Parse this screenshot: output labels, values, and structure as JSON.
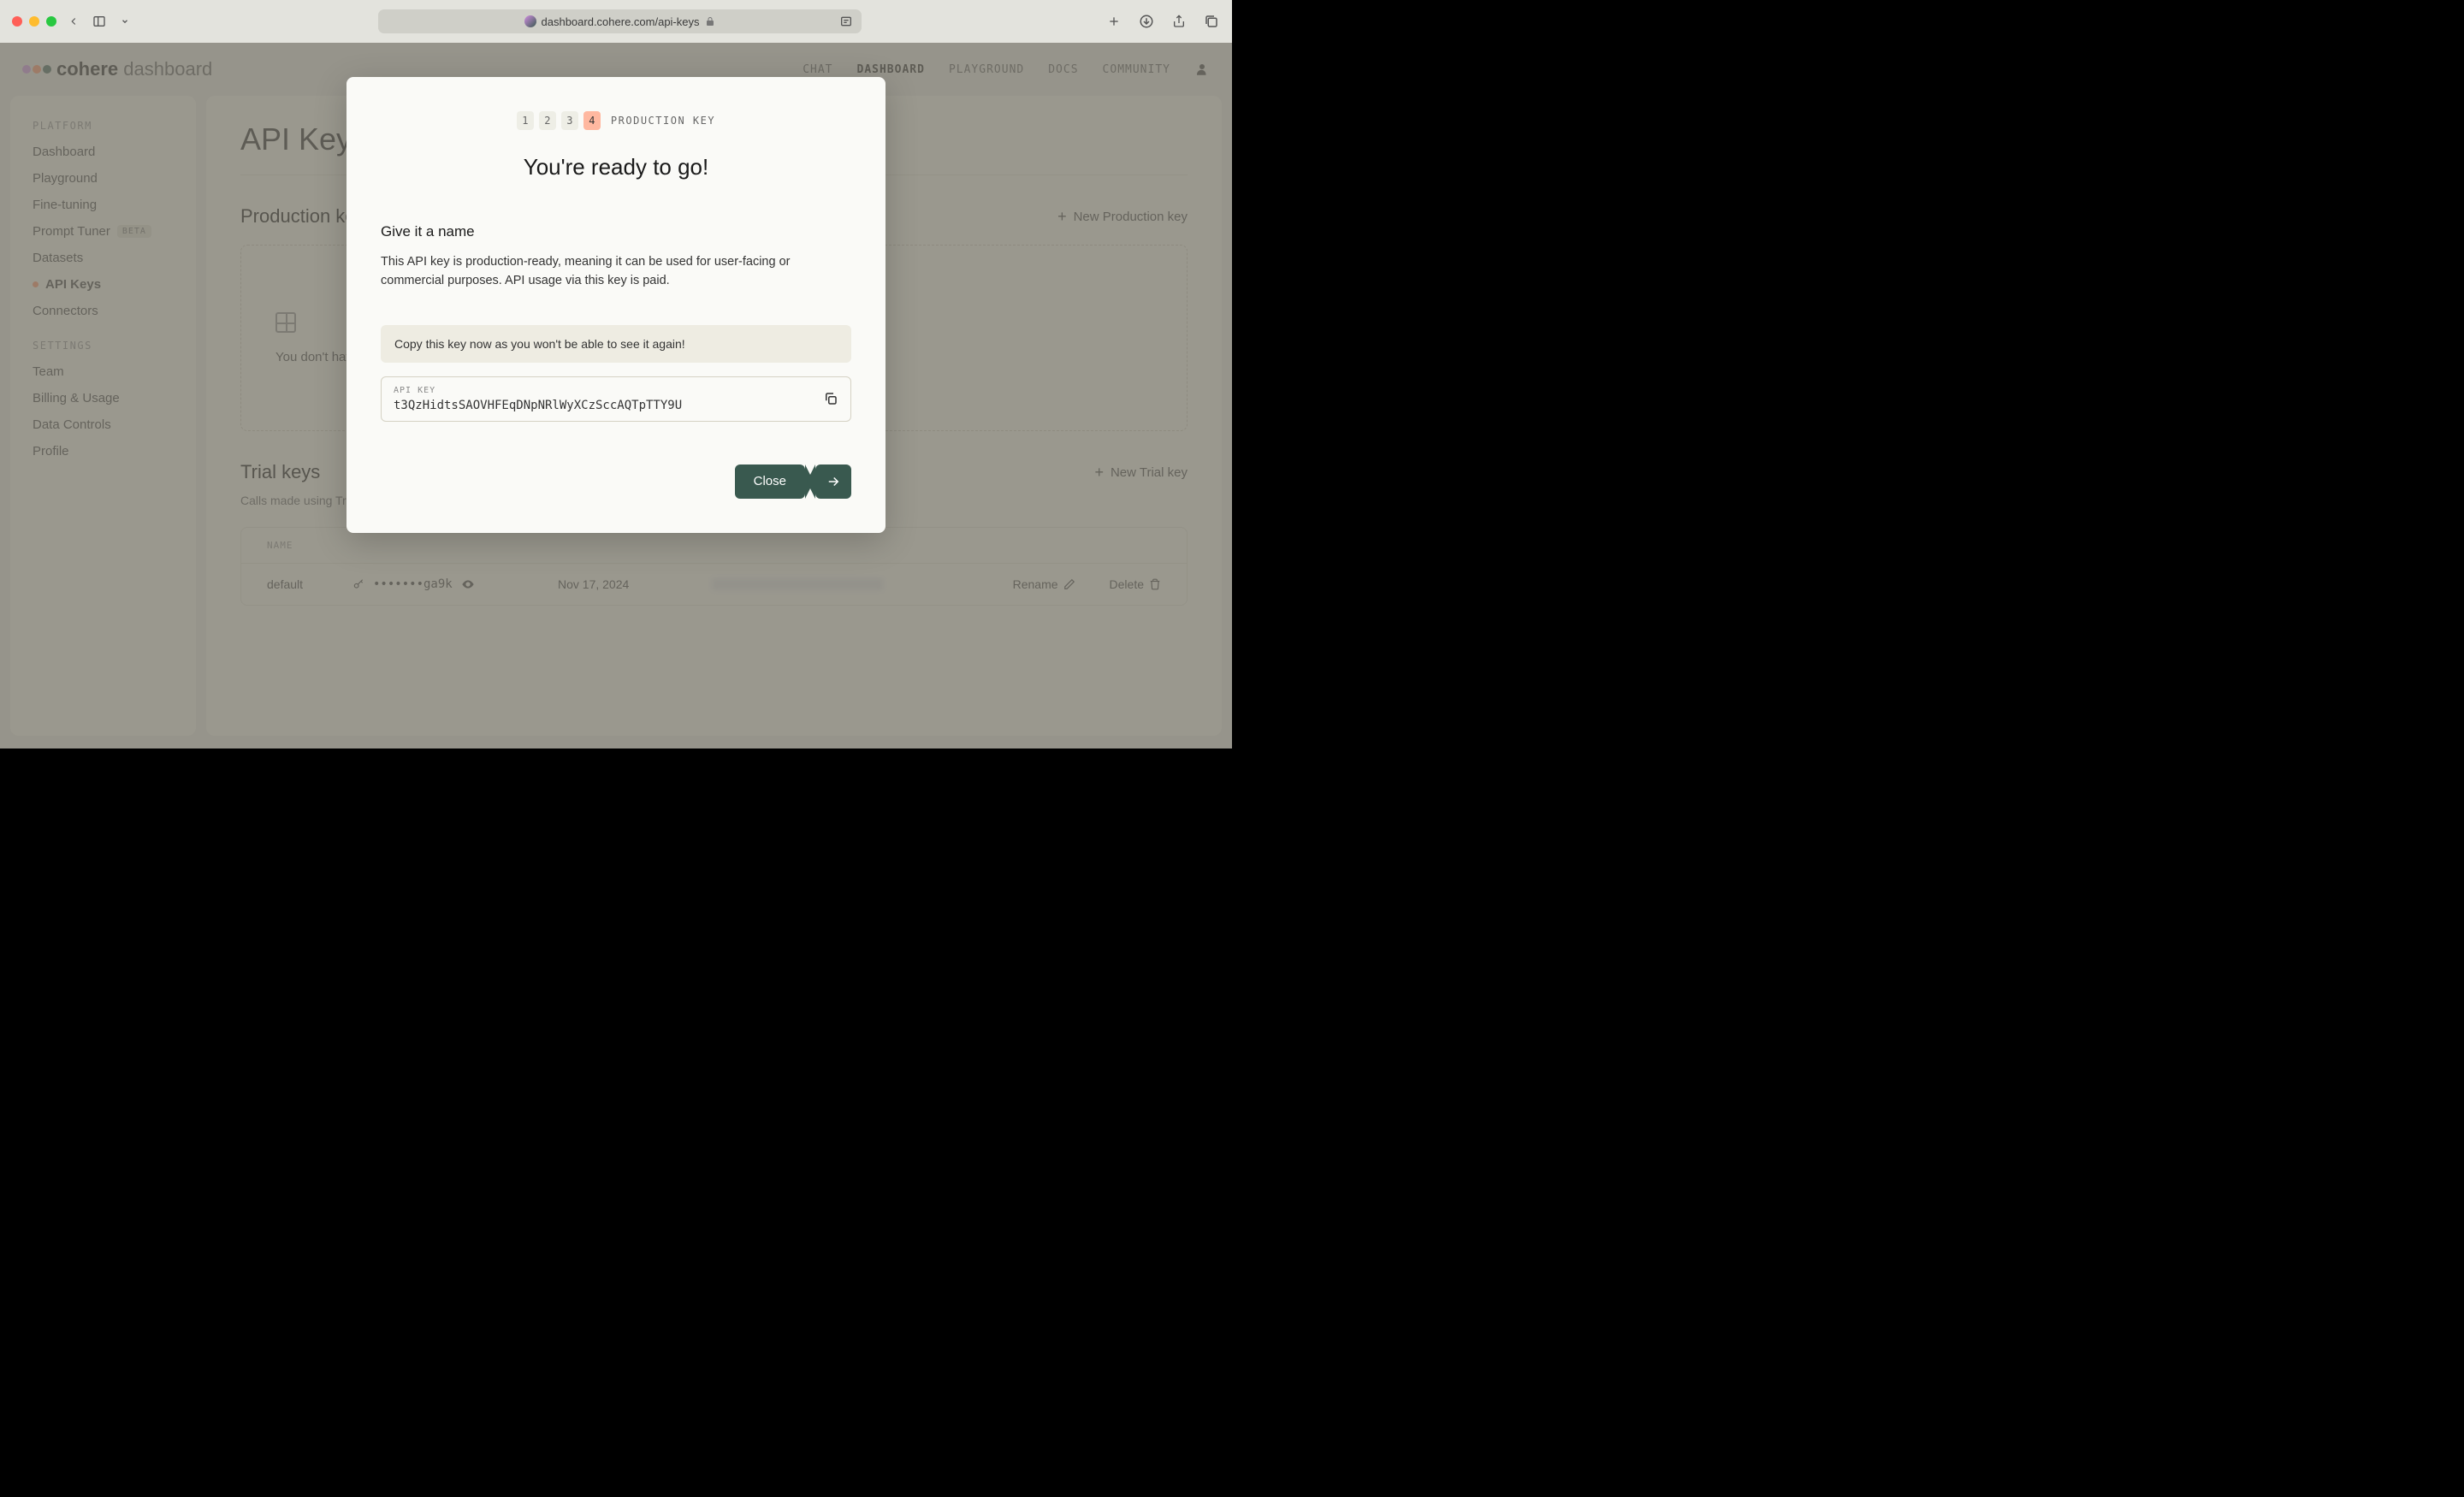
{
  "browser": {
    "url": "dashboard.cohere.com/api-keys"
  },
  "brand": {
    "name_bold": "cohere",
    "name_light": "dashboard"
  },
  "nav": {
    "items": [
      "CHAT",
      "DASHBOARD",
      "PLAYGROUND",
      "DOCS",
      "COMMUNITY"
    ],
    "active_index": 1
  },
  "sidebar": {
    "platform_heading": "PLATFORM",
    "platform_items": [
      {
        "label": "Dashboard"
      },
      {
        "label": "Playground"
      },
      {
        "label": "Fine-tuning"
      },
      {
        "label": "Prompt Tuner",
        "badge": "BETA"
      },
      {
        "label": "Datasets"
      },
      {
        "label": "API Keys",
        "active": true
      },
      {
        "label": "Connectors"
      }
    ],
    "settings_heading": "SETTINGS",
    "settings_items": [
      {
        "label": "Team"
      },
      {
        "label": "Billing & Usage"
      },
      {
        "label": "Data Controls"
      },
      {
        "label": "Profile"
      }
    ]
  },
  "page": {
    "title": "API Keys",
    "production": {
      "heading": "Production keys",
      "new_btn": "New Production key",
      "empty_text": "You don't have any production keys yet."
    },
    "trial": {
      "heading": "Trial keys",
      "new_btn": "New Trial key",
      "description": "Calls made using Trial keys are free of charge. Trial keys are rate-limited, and cannot be used for commercial purposes.",
      "table_header": "NAME",
      "rows": [
        {
          "name": "default",
          "masked": "•••••••ga9k",
          "date": "Nov 17, 2024",
          "rename": "Rename",
          "delete": "Delete"
        }
      ]
    }
  },
  "modal": {
    "steps": [
      "1",
      "2",
      "3",
      "4"
    ],
    "active_step": 3,
    "step_label": "PRODUCTION KEY",
    "title": "You're ready to go!",
    "subtitle": "Give it a name",
    "description": "This API key is production-ready, meaning it can be used for user-facing or commercial purposes. API usage via this key is paid.",
    "warning": "Copy this key now as you won't be able to see it again!",
    "key_label": "API KEY",
    "key_value": "t3QzHidtsSAOVHFEqDNpNRlWyXCzSccAQTpTTY9U",
    "close_btn": "Close"
  }
}
